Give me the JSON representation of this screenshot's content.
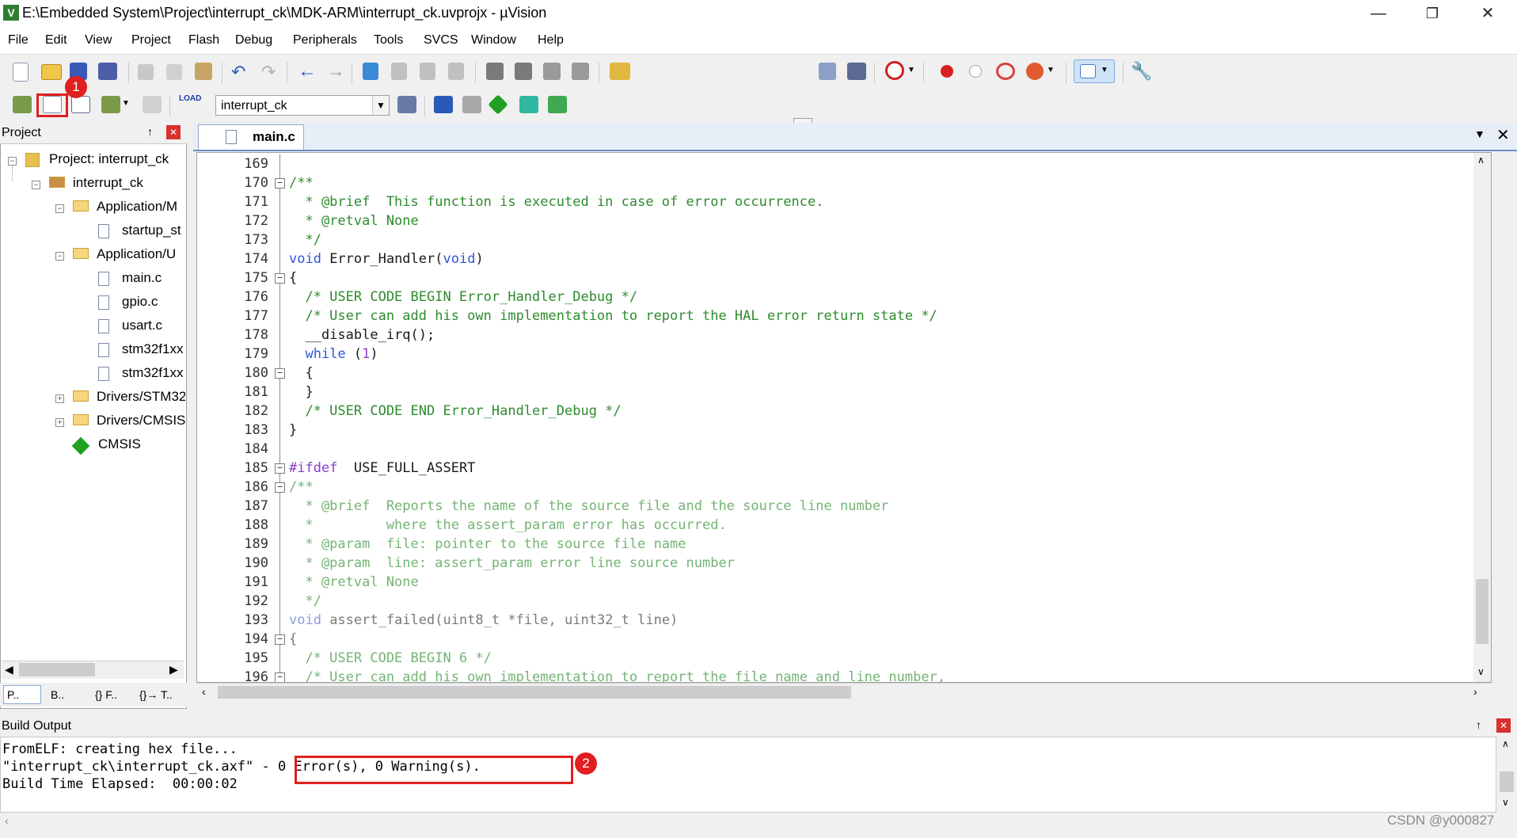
{
  "window": {
    "title": "E:\\Embedded System\\Project\\interrupt_ck\\MDK-ARM\\interrupt_ck.uvprojx - µVision",
    "minimize": "—",
    "maximize": "❐",
    "close": "✕"
  },
  "menu": [
    "File",
    "Edit",
    "View",
    "Project",
    "Flash",
    "Debug",
    "Peripherals",
    "Tools",
    "SVCS",
    "Window",
    "Help"
  ],
  "toolbar2": {
    "target_combo": "interrupt_ck",
    "load_label": "LOAD"
  },
  "project_panel": {
    "title": "Project",
    "pin": "↑",
    "close": "✕",
    "tree": [
      {
        "label": "Project: interrupt_ck",
        "level": 0,
        "icon": "project-icon",
        "expander": "−"
      },
      {
        "label": "interrupt_ck",
        "level": 1,
        "icon": "target-icon",
        "expander": "−"
      },
      {
        "label": "Application/M",
        "level": 2,
        "icon": "folder-icon",
        "expander": "−"
      },
      {
        "label": "startup_st",
        "level": 3,
        "icon": "file-icon",
        "expander": ""
      },
      {
        "label": "Application/U",
        "level": 2,
        "icon": "folder-icon",
        "expander": "−"
      },
      {
        "label": "main.c",
        "level": 3,
        "icon": "file-icon",
        "expander": ""
      },
      {
        "label": "gpio.c",
        "level": 3,
        "icon": "file-icon",
        "expander": ""
      },
      {
        "label": "usart.c",
        "level": 3,
        "icon": "file-icon",
        "expander": ""
      },
      {
        "label": "stm32f1xx",
        "level": 3,
        "icon": "file-icon",
        "expander": ""
      },
      {
        "label": "stm32f1xx",
        "level": 3,
        "icon": "file-icon",
        "expander": ""
      },
      {
        "label": "Drivers/STM32",
        "level": 2,
        "icon": "folder-icon",
        "expander": "+"
      },
      {
        "label": "Drivers/CMSIS",
        "level": 2,
        "icon": "folder-icon",
        "expander": "+"
      },
      {
        "label": "CMSIS",
        "level": 2,
        "icon": "cmsis-icon",
        "expander": ""
      }
    ],
    "bottom_tabs": [
      "P..",
      "B..",
      "{} F..",
      "{}→ T.."
    ]
  },
  "editor": {
    "tab_label": "main.c",
    "lines": [
      {
        "num": "169",
        "fold": "",
        "text": "",
        "cls": "c-black"
      },
      {
        "num": "170",
        "fold": "−",
        "text": "/**",
        "cls": "c-green"
      },
      {
        "num": "171",
        "fold": "",
        "text": "  * @brief  This function is executed in case of error occurrence.",
        "cls": "c-green"
      },
      {
        "num": "172",
        "fold": "",
        "text": "  * @retval None",
        "cls": "c-green"
      },
      {
        "num": "173",
        "fold": "",
        "text": "  */",
        "cls": "c-green"
      },
      {
        "num": "174",
        "fold": "",
        "text": "void Error_Handler(void)",
        "cls": "c-mixed-void"
      },
      {
        "num": "175",
        "fold": "−",
        "text": "{",
        "cls": "c-black"
      },
      {
        "num": "176",
        "fold": "",
        "text": "  /* USER CODE BEGIN Error_Handler_Debug */",
        "cls": "c-green"
      },
      {
        "num": "177",
        "fold": "",
        "text": "  /* User can add his own implementation to report the HAL error return state */",
        "cls": "c-green"
      },
      {
        "num": "178",
        "fold": "",
        "text": "  __disable_irq();",
        "cls": "c-black"
      },
      {
        "num": "179",
        "fold": "",
        "text": "  while (1)",
        "cls": "c-mixed-while"
      },
      {
        "num": "180",
        "fold": "−",
        "text": "  {",
        "cls": "c-black"
      },
      {
        "num": "181",
        "fold": "",
        "text": "  }",
        "cls": "c-black"
      },
      {
        "num": "182",
        "fold": "",
        "text": "  /* USER CODE END Error_Handler_Debug */",
        "cls": "c-green"
      },
      {
        "num": "183",
        "fold": "",
        "text": "}",
        "cls": "c-black"
      },
      {
        "num": "184",
        "fold": "",
        "text": "",
        "cls": "c-black"
      },
      {
        "num": "185",
        "fold": "−",
        "text": "#ifdef  USE_FULL_ASSERT",
        "cls": "c-mixed-ifdef"
      },
      {
        "num": "186",
        "fold": "−",
        "text": "/**",
        "cls": "c-lgreen"
      },
      {
        "num": "187",
        "fold": "",
        "text": "  * @brief  Reports the name of the source file and the source line number",
        "cls": "c-lgreen"
      },
      {
        "num": "188",
        "fold": "",
        "text": "  *         where the assert_param error has occurred.",
        "cls": "c-lgreen"
      },
      {
        "num": "189",
        "fold": "",
        "text": "  * @param  file: pointer to the source file name",
        "cls": "c-lgreen"
      },
      {
        "num": "190",
        "fold": "",
        "text": "  * @param  line: assert_param error line source number",
        "cls": "c-lgreen"
      },
      {
        "num": "191",
        "fold": "",
        "text": "  * @retval None",
        "cls": "c-lgreen"
      },
      {
        "num": "192",
        "fold": "",
        "text": "  */",
        "cls": "c-lgreen"
      },
      {
        "num": "193",
        "fold": "",
        "text": "void assert_failed(uint8_t *file, uint32_t line)",
        "cls": "c-mixed-void2"
      },
      {
        "num": "194",
        "fold": "−",
        "text": "{",
        "cls": "c-gray"
      },
      {
        "num": "195",
        "fold": "",
        "text": "  /* USER CODE BEGIN 6 */",
        "cls": "c-lgreen"
      },
      {
        "num": "196",
        "fold": "−",
        "text": "  /* User can add his own implementation to report the file name and line number,",
        "cls": "c-lgreen"
      }
    ]
  },
  "build_output": {
    "title": "Build Output",
    "lines": [
      "FromELF: creating hex file...",
      "\"interrupt_ck\\interrupt_ck.axf\" - 0 Error(s), 0 Warning(s).",
      "Build Time Elapsed:  00:00:02"
    ]
  },
  "annotations": {
    "marker1": "1",
    "marker2": "2"
  },
  "watermark": "CSDN @y000827",
  "colors": {
    "accent_red": "#e02020",
    "comment_green": "#2e8b2e",
    "keyword_blue": "#2f57d7"
  }
}
